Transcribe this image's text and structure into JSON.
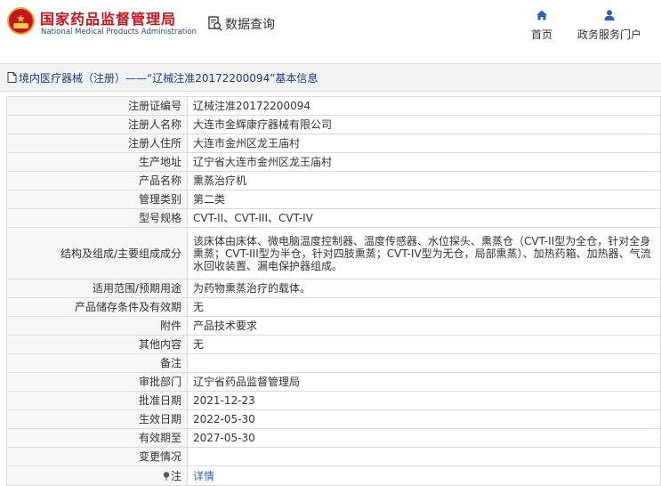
{
  "header": {
    "logo_cn": "国家药品监督管理局",
    "logo_en": "National Medical Products Administration",
    "search_label": "数据查询",
    "nav_home": "首页",
    "nav_portal": "政务服务门户"
  },
  "title_bar": {
    "text": "境内医疗器械（注册）——“辽械注准20172200094”基本信息"
  },
  "rows": [
    {
      "label": "注册证编号",
      "value": "辽械注准20172200094"
    },
    {
      "label": "注册人名称",
      "value": "大连市金辉康疗器械有限公司"
    },
    {
      "label": "注册人住所",
      "value": "大连市金州区龙王庙村"
    },
    {
      "label": "生产地址",
      "value": "辽宁省大连市金州区龙王庙村"
    },
    {
      "label": "产品名称",
      "value": "熏蒸治疗机"
    },
    {
      "label": "管理类别",
      "value": "第二类"
    },
    {
      "label": "型号规格",
      "value": "CVT-II、CVT-III、CVT-IV"
    },
    {
      "label": "结构及组成/主要组成成分",
      "value": "该床体由床体、微电脑温度控制器、温度传感器、水位探头、熏蒸仓（CVT-II型为全仓，针对全身熏蒸；CVT-III型为半仓，针对四肢熏蒸；CVT-IV型为无仓，局部熏蒸）、加热药箱、加热器、气流水回收装置、漏电保护器组成。"
    },
    {
      "label": "适用范围/预期用途",
      "value": "为药物熏蒸治疗的载体。"
    },
    {
      "label": "产品储存条件及有效期",
      "value": "无"
    },
    {
      "label": "附件",
      "value": "产品技术要求"
    },
    {
      "label": "其他内容",
      "value": "无"
    },
    {
      "label": "备注",
      "value": ""
    },
    {
      "label": "审批部门",
      "value": "辽宁省药品监督管理局"
    },
    {
      "label": "批准日期",
      "value": "2021-12-23"
    },
    {
      "label": "生效日期",
      "value": "2022-05-30"
    },
    {
      "label": "有效期至",
      "value": "2027-05-30"
    },
    {
      "label": "变更情况",
      "value": ""
    },
    {
      "label": "注",
      "value": "详情"
    }
  ],
  "colors": {
    "brand_red": "#c8151d",
    "brand_blue": "#1f4a8c",
    "link_blue": "#2e62b6",
    "title_blue": "#1f3c7a"
  },
  "icons": [
    "emblem-logo",
    "search-doc-icon",
    "home-icon",
    "user-icon",
    "document-icon",
    "pin-icon"
  ]
}
